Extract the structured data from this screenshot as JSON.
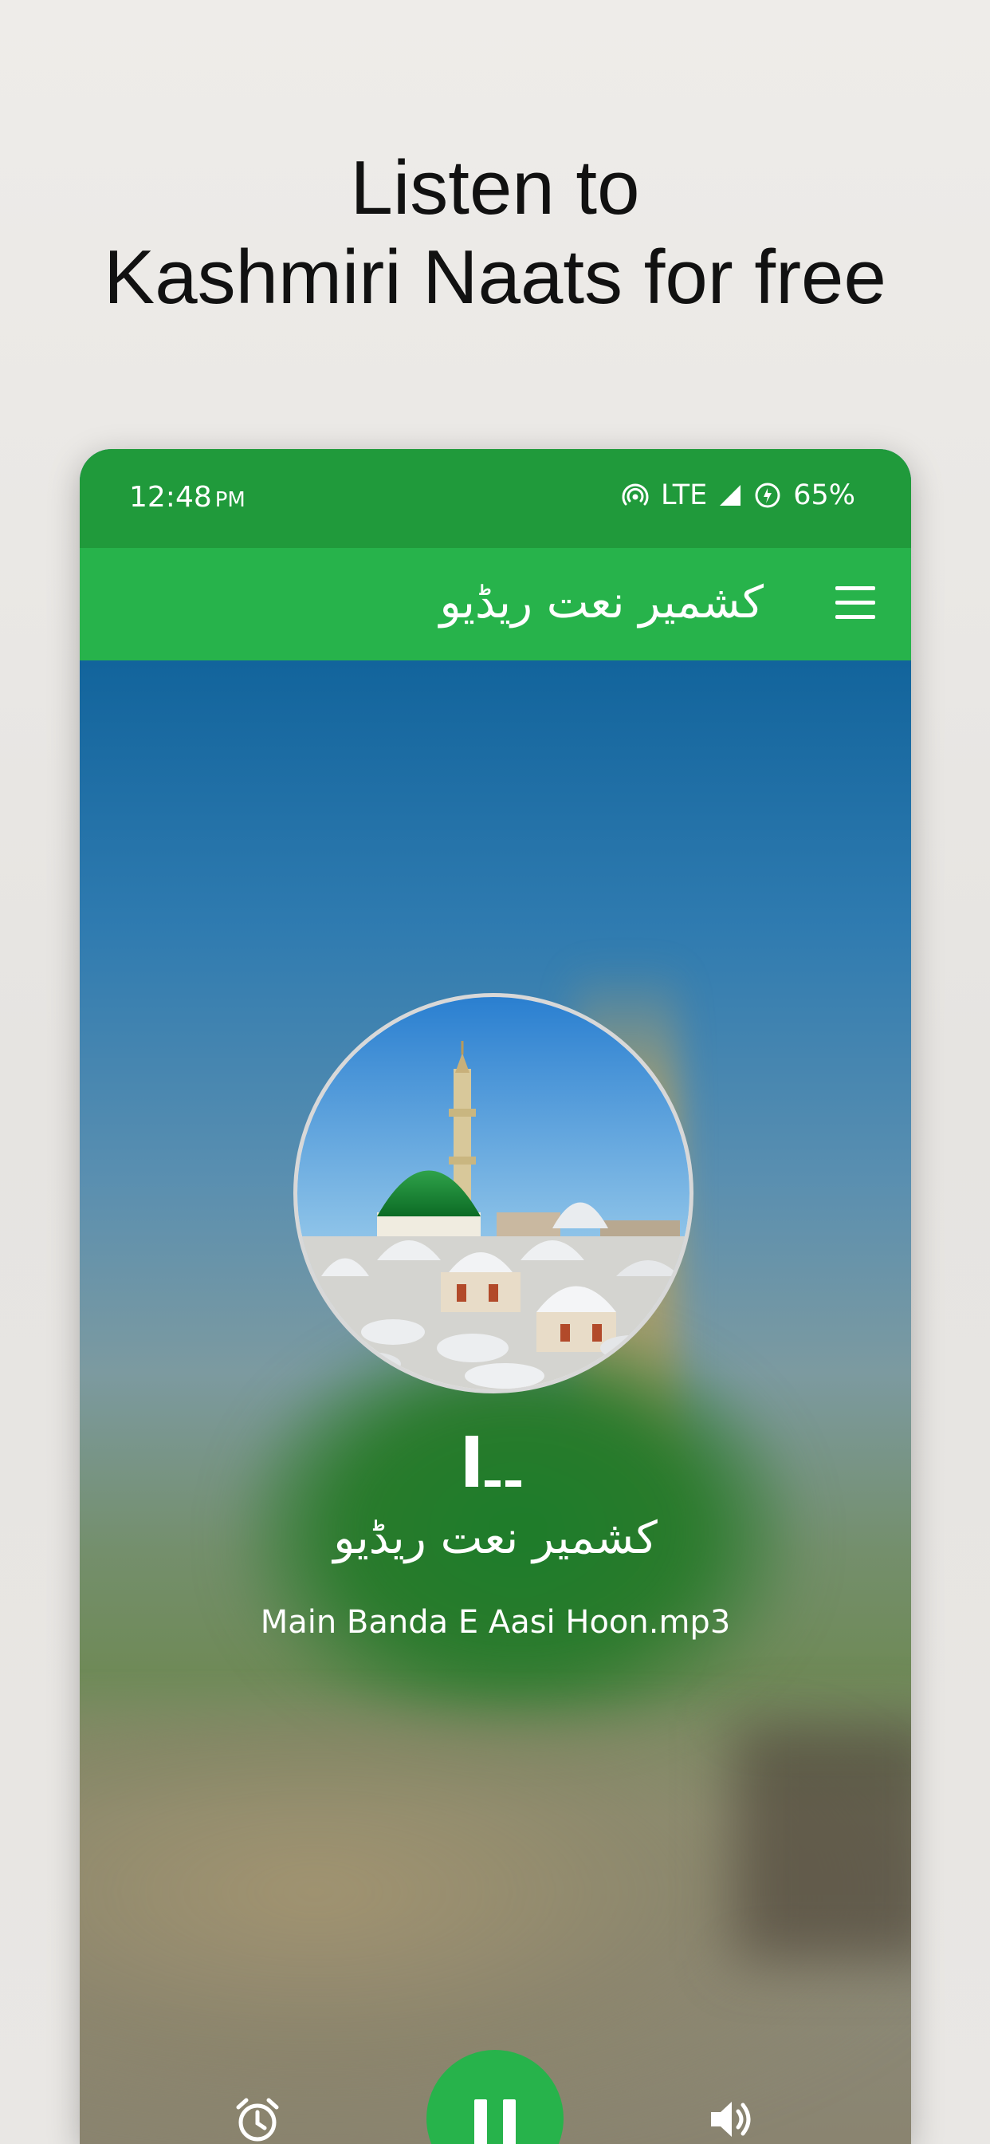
{
  "promo": {
    "line1": "Listen to",
    "line2": "Kashmiri Naats for free"
  },
  "status_bar": {
    "time": "12:48",
    "ampm": "PM",
    "network": "LTE",
    "battery": "65%"
  },
  "app_bar": {
    "title": "کشمیر نعت ریڈیو",
    "menu_icon": "hamburger-menu-icon"
  },
  "player": {
    "station_name": "کشمیر نعت ریڈیو",
    "track_name": "Main Banda E Aasi Hoon.mp3",
    "artwork_alt": "mosque-artwork",
    "equalizer_icon": "equalizer-icon",
    "controls": {
      "alarm_icon": "alarm-clock-icon",
      "play_pause_icon": "pause-icon",
      "volume_icon": "volume-icon"
    }
  },
  "colors": {
    "status_bar": "#209a3b",
    "app_bar": "#27b34b",
    "accent": "#27b34b"
  }
}
